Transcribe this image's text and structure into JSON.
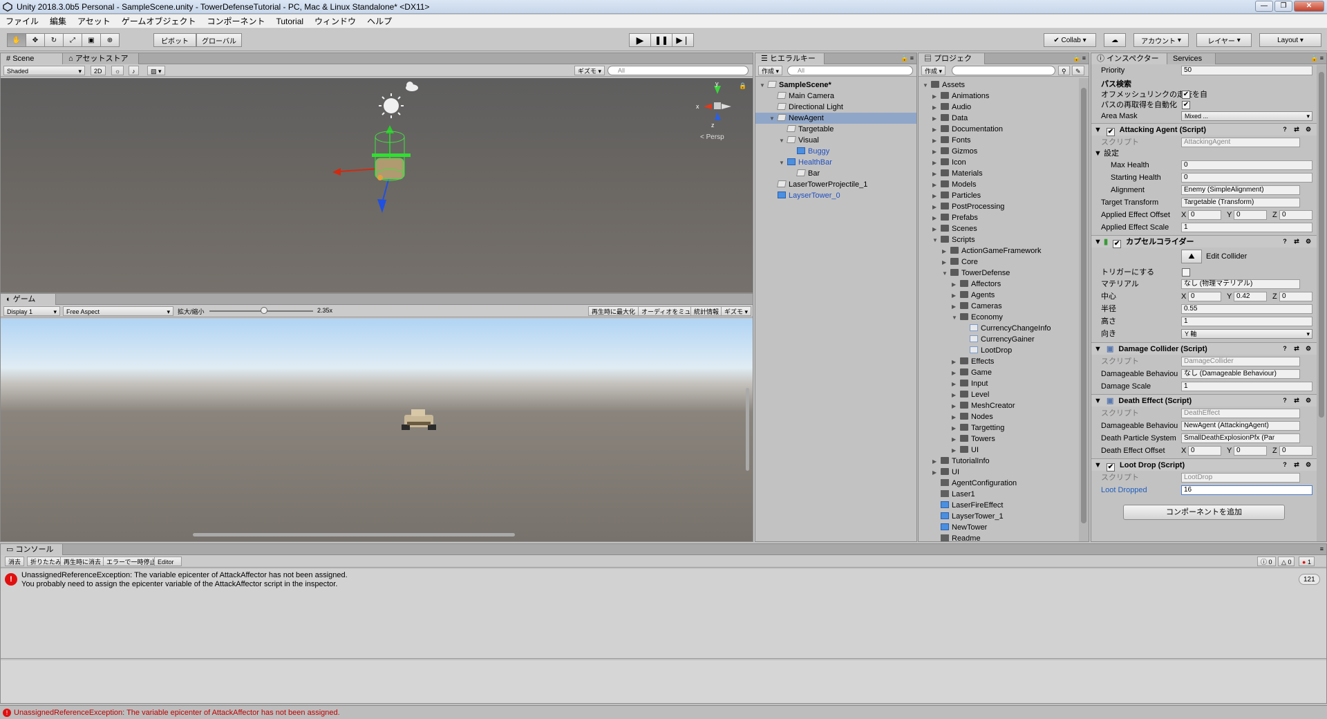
{
  "window": {
    "title": "Unity 2018.3.0b5 Personal - SampleScene.unity - TowerDefenseTutorial - PC, Mac & Linux Standalone* <DX11>"
  },
  "menu": [
    "ファイル",
    "編集",
    "アセット",
    "ゲームオブジェクト",
    "コンポーネント",
    "Tutorial",
    "ウィンドウ",
    "ヘルプ"
  ],
  "toolbar": {
    "pivot": "ピボット",
    "global": "グローバル",
    "collab": "Collab",
    "account": "アカウント",
    "layers": "レイヤー",
    "layout": "Layout"
  },
  "scene": {
    "tab": "Scene",
    "tab2": "アセットストア",
    "shading": "Shaded",
    "mode2d": "2D",
    "gizmos": "ギズモ",
    "search": "All",
    "persp": "< Persp"
  },
  "game": {
    "tab": "ゲーム",
    "display": "Display 1",
    "aspect": "Free Aspect",
    "scale_label": "拡大/縮小",
    "scale_value": "2.35x",
    "maximize": "再生時に最大化",
    "mute": "オーディオをミュート",
    "stats": "統計情報",
    "gizmos": "ギズモ"
  },
  "hierarchy": {
    "tab": "ヒエラルキー",
    "create": "作成",
    "search": "All",
    "items": [
      {
        "label": "SampleScene*",
        "depth": 0,
        "kind": "scene"
      },
      {
        "label": "Main Camera",
        "depth": 1,
        "kind": "go"
      },
      {
        "label": "Directional Light",
        "depth": 1,
        "kind": "go"
      },
      {
        "label": "NewAgent",
        "depth": 1,
        "kind": "go",
        "selected": true
      },
      {
        "label": "Targetable",
        "depth": 2,
        "kind": "go"
      },
      {
        "label": "Visual",
        "depth": 2,
        "kind": "go"
      },
      {
        "label": "Buggy",
        "depth": 3,
        "kind": "prefab"
      },
      {
        "label": "HealthBar",
        "depth": 2,
        "kind": "prefab"
      },
      {
        "label": "Bar",
        "depth": 3,
        "kind": "go"
      },
      {
        "label": "LaserTowerProjectile_1",
        "depth": 1,
        "kind": "go"
      },
      {
        "label": "LayserTower_0",
        "depth": 1,
        "kind": "prefab"
      }
    ]
  },
  "project": {
    "tab": "プロジェクト",
    "create": "作成",
    "items": [
      {
        "label": "Assets",
        "depth": 0
      },
      {
        "label": "Animations",
        "depth": 1
      },
      {
        "label": "Audio",
        "depth": 1
      },
      {
        "label": "Data",
        "depth": 1
      },
      {
        "label": "Documentation",
        "depth": 1
      },
      {
        "label": "Fonts",
        "depth": 1
      },
      {
        "label": "Gizmos",
        "depth": 1
      },
      {
        "label": "Icon",
        "depth": 1
      },
      {
        "label": "Materials",
        "depth": 1
      },
      {
        "label": "Models",
        "depth": 1
      },
      {
        "label": "Particles",
        "depth": 1
      },
      {
        "label": "PostProcessing",
        "depth": 1
      },
      {
        "label": "Prefabs",
        "depth": 1
      },
      {
        "label": "Scenes",
        "depth": 1
      },
      {
        "label": "Scripts",
        "depth": 1
      },
      {
        "label": "ActionGameFramework",
        "depth": 2
      },
      {
        "label": "Core",
        "depth": 2
      },
      {
        "label": "TowerDefense",
        "depth": 2
      },
      {
        "label": "Affectors",
        "depth": 3
      },
      {
        "label": "Agents",
        "depth": 3
      },
      {
        "label": "Cameras",
        "depth": 3
      },
      {
        "label": "Economy",
        "depth": 3
      },
      {
        "label": "CurrencyChangeInfo",
        "depth": 4,
        "kind": "script"
      },
      {
        "label": "CurrencyGainer",
        "depth": 4,
        "kind": "script"
      },
      {
        "label": "LootDrop",
        "depth": 4,
        "kind": "script"
      },
      {
        "label": "Effects",
        "depth": 3
      },
      {
        "label": "Game",
        "depth": 3
      },
      {
        "label": "Input",
        "depth": 3
      },
      {
        "label": "Level",
        "depth": 3
      },
      {
        "label": "MeshCreator",
        "depth": 3
      },
      {
        "label": "Nodes",
        "depth": 3
      },
      {
        "label": "Targetting",
        "depth": 3
      },
      {
        "label": "Towers",
        "depth": 3
      },
      {
        "label": "UI",
        "depth": 3
      },
      {
        "label": "TutorialInfo",
        "depth": 1
      },
      {
        "label": "UI",
        "depth": 1
      },
      {
        "label": "AgentConfiguration",
        "depth": 1,
        "kind": "asset"
      },
      {
        "label": "Laser1",
        "depth": 1,
        "kind": "asset"
      },
      {
        "label": "LaserFireEffect",
        "depth": 1,
        "kind": "prefab"
      },
      {
        "label": "LayserTower_1",
        "depth": 1,
        "kind": "prefab"
      },
      {
        "label": "NewTower",
        "depth": 1,
        "kind": "prefab"
      },
      {
        "label": "Readme",
        "depth": 1,
        "kind": "asset"
      }
    ]
  },
  "inspector": {
    "tab": "インスペクター",
    "tab2": "Services",
    "priority_label": "Priority",
    "priority": "50",
    "path_section": "パス検索",
    "offmesh_label": "オフメッシュリンクの走査を自",
    "autorepath_label": "パスの再取得を自動化",
    "area_mask_label": "Area Mask",
    "area_mask": "Mixed ...",
    "attacking": {
      "title": "Attacking Agent (Script)",
      "script_label": "スクリプト",
      "script": "AttackingAgent",
      "settings": "設定",
      "max_health_label": "Max Health",
      "max_health": "0",
      "start_health_label": "Starting Health",
      "start_health": "0",
      "alignment_label": "Alignment",
      "alignment": "Enemy (SimpleAlignment)",
      "target_label": "Target Transform",
      "target": "Targetable (Transform)",
      "offset_label": "Applied Effect Offset",
      "ox": "0",
      "oy": "0",
      "oz": "0",
      "scale_label": "Applied Effect Scale",
      "scale": "1"
    },
    "capsule": {
      "title": "カプセルコライダー",
      "edit": "Edit Collider",
      "trigger_label": "トリガーにする",
      "material_label": "マテリアル",
      "material": "なし (物理マテリアル)",
      "center_label": "中心",
      "cx": "0",
      "cy": "0.42",
      "cz": "0",
      "radius_label": "半径",
      "radius": "0.55",
      "height_label": "高さ",
      "height": "1",
      "dir_label": "向き",
      "dir": "Y 軸"
    },
    "damage": {
      "title": "Damage Collider (Script)",
      "script_label": "スクリプト",
      "script": "DamageCollider",
      "behav_label": "Damageable Behaviou",
      "behav": "なし (Damageable Behaviour)",
      "scale_label": "Damage Scale",
      "scale": "1"
    },
    "death": {
      "title": "Death Effect (Script)",
      "script_label": "スクリプト",
      "script": "DeathEffect",
      "behav_label": "Damageable Behaviou",
      "behav": "NewAgent (AttackingAgent)",
      "particle_label": "Death Particle System",
      "particle": "SmallDeathExplosionPfx (Par",
      "offset_label": "Death Effect Offset",
      "ox": "0",
      "oy": "0",
      "oz": "0"
    },
    "loot": {
      "title": "Loot Drop (Script)",
      "script_label": "スクリプト",
      "script": "LootDrop",
      "dropped_label": "Loot Dropped",
      "dropped": "16"
    },
    "add_component": "コンポーネントを追加"
  },
  "console": {
    "tab": "コンソール",
    "buttons": [
      "消去",
      "折りたたみ",
      "再生時に消去",
      "エラーで一時停止",
      "Editor"
    ],
    "counts": {
      "info": "0",
      "warn": "0",
      "error": "1"
    },
    "line1": "UnassignedReferenceException: The variable epicenter of AttackAffector has not been assigned.",
    "line2": "You probably need to assign the epicenter variable of the AttackAffector script in the inspector.",
    "collapse_count": "121"
  },
  "statusbar": "UnassignedReferenceException: The variable epicenter of AttackAffector has not been assigned.",
  "colors": {
    "error": "#e01010",
    "selection": "#8fa6c8",
    "accent_blue": "#2060c0",
    "sky_top": "#b8d8f4",
    "ground": "#7a7570"
  }
}
